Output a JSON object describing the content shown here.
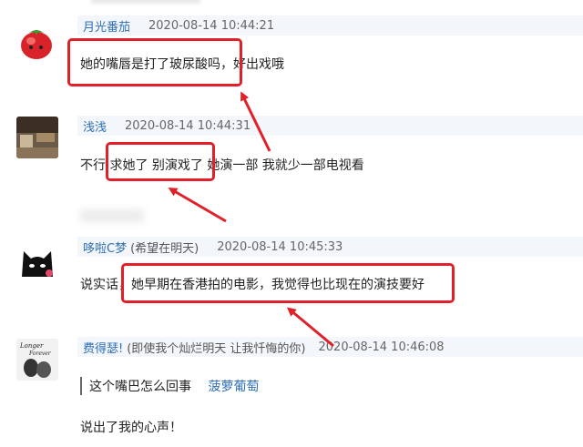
{
  "colors": {
    "annotation": "#e0212a",
    "username": "#2e6eb5",
    "meta_bg": "#f3f6fa"
  },
  "comments": [
    {
      "user": "月光番茄",
      "signature": "",
      "time": "2020-08-14 10:44:21",
      "text": "她的嘴唇是打了玻尿酸吗，好出戏哦",
      "avatar_icon": "tomato-avatar"
    },
    {
      "user": "浅浅",
      "signature": "",
      "time": "2020-08-14 10:44:31",
      "text": "不行 求她了 别演戏了 她演一部 我就少一部电视看",
      "avatar_icon": "room-photo-avatar"
    },
    {
      "user": "哆啦C梦",
      "signature": "(希望在明天)",
      "time": "2020-08-14 10:45:33",
      "text": "说实话，她早期在香港拍的电影，我觉得也比现在的演技要好",
      "avatar_icon": "black-cat-avatar"
    },
    {
      "user": "费得瑟!",
      "signature": "(即使我个灿烂明天 让我忏悔的你)",
      "time": "2020-08-14 10:46:08",
      "quote_text": "这个嘴巴怎么回事",
      "quote_user": "菠萝葡萄",
      "text": "说出了我的心声！",
      "avatar_icon": "forever-avatar"
    }
  ]
}
